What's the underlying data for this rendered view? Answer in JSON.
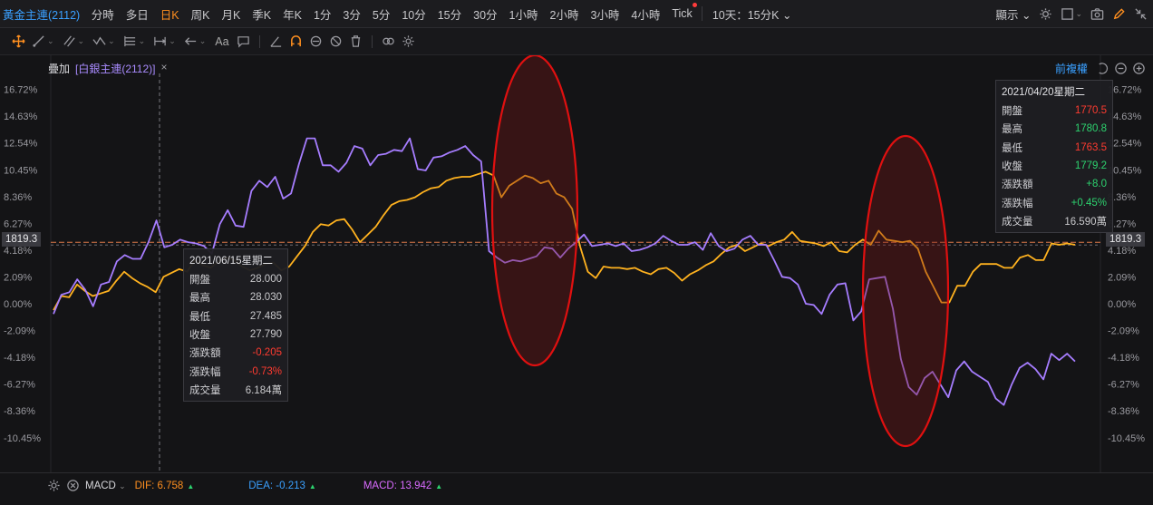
{
  "toolbar": {
    "symbol": "黃金主連(2112)",
    "periods": [
      "分時",
      "多日",
      "日K",
      "周K",
      "月K",
      "季K",
      "年K",
      "1分",
      "3分",
      "5分",
      "10分",
      "15分",
      "30分",
      "1小時",
      "2小時",
      "3小時",
      "4小時",
      "Tick"
    ],
    "active_period": "日K",
    "multi_day": "10天：15分K",
    "display": "顯示"
  },
  "overlay": {
    "label": "疊加",
    "symbol": "[白銀主連(2112)]",
    "close": "×",
    "adjust": "前複權"
  },
  "price_tag": "1819.3",
  "left_info": {
    "date": "2021/06/15星期二",
    "rows": [
      {
        "label": "開盤",
        "value": "28.000",
        "tone": "neu"
      },
      {
        "label": "最高",
        "value": "28.030",
        "tone": "neu"
      },
      {
        "label": "最低",
        "value": "27.485",
        "tone": "neu"
      },
      {
        "label": "收盤",
        "value": "27.790",
        "tone": "neu"
      },
      {
        "label": "漲跌額",
        "value": "-0.205",
        "tone": "up"
      },
      {
        "label": "漲跌幅",
        "value": "-0.73%",
        "tone": "up"
      },
      {
        "label": "成交量",
        "value": "6.184萬",
        "tone": "neu"
      }
    ]
  },
  "right_info": {
    "date": "2021/04/20星期二",
    "rows": [
      {
        "label": "開盤",
        "value": "1770.5",
        "tone": "up"
      },
      {
        "label": "最高",
        "value": "1780.8",
        "tone": "down"
      },
      {
        "label": "最低",
        "value": "1763.5",
        "tone": "up"
      },
      {
        "label": "收盤",
        "value": "1779.2",
        "tone": "down"
      },
      {
        "label": "漲跌額",
        "value": "+8.0",
        "tone": "down"
      },
      {
        "label": "漲跌幅",
        "value": "+0.45%",
        "tone": "down"
      },
      {
        "label": "成交量",
        "value": "16.590萬",
        "tone": "neu"
      }
    ]
  },
  "macd": {
    "name": "MACD",
    "dif": "DIF: 6.758",
    "dea": "DEA: -0.213",
    "macd": "MACD: 13.942",
    "colors": {
      "dif": "#ff8f1f",
      "dea": "#3aa0ff",
      "macd": "#d96bff"
    }
  },
  "chart_data": {
    "type": "line",
    "y_ticks": [
      "16.72%",
      "14.63%",
      "12.54%",
      "10.45%",
      "8.36%",
      "6.27%",
      "4.18%",
      "2.09%",
      "0.00%",
      "-2.09%",
      "-4.18%",
      "-6.27%",
      "-8.36%",
      "-10.45%"
    ],
    "ylim": [
      -10.45,
      16.72
    ],
    "reference_level": 4.65,
    "series": [
      {
        "color": "#ffb21f",
        "values": [
          -0.5,
          0.6,
          0.5,
          1.5,
          1.0,
          0.6,
          0.8,
          1.0,
          1.8,
          2.5,
          2.0,
          1.6,
          1.3,
          0.9,
          2.1,
          2.4,
          2.7,
          2.5,
          3.4,
          3.0,
          2.8,
          3.3,
          3.6,
          3.4,
          2.9,
          2.6,
          2.8,
          3.1,
          3.2,
          2.6,
          2.9,
          3.7,
          4.5,
          5.6,
          6.2,
          6.1,
          6.5,
          6.6,
          5.8,
          4.8,
          5.4,
          6.0,
          6.9,
          7.7,
          8.0,
          8.1,
          8.3,
          8.7,
          9.0,
          9.1,
          9.6,
          9.8,
          9.9,
          9.9,
          10.1,
          10.3,
          10.0,
          8.3,
          9.2,
          9.6,
          10.0,
          9.8,
          9.4,
          9.6,
          8.6,
          8.3,
          7.4,
          4.5,
          2.5,
          2.0,
          2.9,
          2.8,
          2.8,
          2.7,
          2.8,
          2.5,
          2.3,
          2.7,
          2.8,
          2.4,
          1.8,
          2.3,
          2.6,
          3.0,
          3.3,
          3.9,
          4.4,
          4.6,
          4.1,
          4.4,
          4.7,
          4.5,
          4.8,
          5.0,
          5.6,
          4.9,
          4.8,
          4.7,
          4.5,
          4.8,
          4.1,
          4.0,
          4.6,
          5.0,
          4.6,
          5.7,
          5.0,
          4.9,
          4.8,
          4.9,
          4.3,
          2.5,
          1.3,
          0.1,
          0.1,
          1.4,
          1.4,
          2.5,
          3.1,
          3.1,
          3.1,
          2.8,
          2.8,
          3.6,
          3.8,
          3.4,
          3.4,
          4.7,
          4.6,
          4.7,
          4.6
        ]
      },
      {
        "color": "#a67dff",
        "values": [
          -0.8,
          0.7,
          0.9,
          1.9,
          1.1,
          -0.2,
          1.5,
          1.7,
          3.3,
          3.8,
          3.5,
          3.5,
          4.8,
          6.5,
          4.4,
          4.6,
          5.0,
          4.8,
          4.7,
          4.5,
          3.9,
          6.2,
          7.3,
          6.1,
          6.0,
          8.8,
          9.6,
          9.1,
          9.9,
          8.2,
          8.6,
          10.9,
          12.9,
          12.9,
          10.8,
          10.8,
          10.3,
          11.0,
          12.3,
          12.1,
          10.8,
          11.6,
          11.7,
          12.0,
          11.9,
          12.9,
          10.5,
          10.4,
          11.4,
          11.5,
          11.8,
          12.0,
          12.3,
          11.6,
          11.1,
          4.1,
          3.6,
          3.2,
          3.4,
          3.3,
          3.5,
          3.7,
          4.4,
          4.3,
          3.6,
          4.3,
          4.8,
          5.4,
          4.5,
          4.6,
          4.7,
          4.5,
          4.7,
          4.1,
          4.2,
          4.4,
          4.7,
          5.3,
          4.9,
          4.6,
          4.6,
          4.8,
          4.2,
          5.5,
          4.5,
          4.1,
          4.3,
          5.0,
          5.3,
          4.6,
          4.6,
          3.4,
          2.1,
          2.0,
          1.5,
          0.0,
          -0.1,
          -0.8,
          0.7,
          1.5,
          1.6,
          -1.3,
          -0.6,
          1.9,
          2.0,
          2.1,
          -0.4,
          -4.3,
          -6.5,
          -7.1,
          -5.8,
          -5.3,
          -6.3,
          -7.3,
          -5.2,
          -4.5,
          -5.3,
          -5.7,
          -6.1,
          -7.4,
          -7.9,
          -6.3,
          -5.0,
          -4.6,
          -5.1,
          -5.9,
          -3.9,
          -4.4,
          -3.9,
          -4.5
        ]
      }
    ]
  }
}
